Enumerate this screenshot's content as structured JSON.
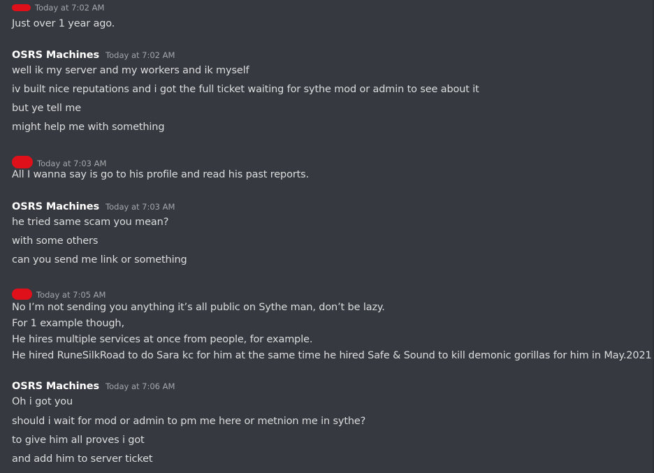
{
  "messages": [
    {
      "author": "",
      "timestamp": "Today at 7:02 AM",
      "lines": [
        "Just over 1 year ago."
      ]
    },
    {
      "author": "OSRS Machines",
      "timestamp": "Today at 7:02 AM",
      "lines": [
        "well ik my server and my workers and ik myself",
        "iv built nice reputations and i got the full ticket waiting for sythe mod or admin to see about it",
        "but ye tell me",
        "might help me with something"
      ]
    },
    {
      "author": "",
      "timestamp": "Today at 7:03 AM",
      "lines": [
        "All I wanna say is go to his profile and read his past reports."
      ]
    },
    {
      "author": "OSRS Machines",
      "timestamp": "Today at 7:03 AM",
      "lines": [
        "he tried same scam you mean?",
        "with some others",
        "can you send me link or something"
      ]
    },
    {
      "author": "",
      "timestamp": "Today at 7:05 AM",
      "lines": [
        "No I’m not sending you anything it’s all public on Sythe man, don’t be lazy.",
        "For 1 example though,",
        "He hires multiple services at once from people, for example.",
        "He hired RuneSilkRoad to do Sara kc for him at the same time he hired Safe & Sound to kill demonic gorillas for him in May.2021."
      ]
    },
    {
      "author": "OSRS Machines",
      "timestamp": "Today at 7:06 AM",
      "lines": [
        "Oh i got you",
        "should i wait for mod or admin to pm me here or metnion me in sythe?",
        "to give him all proves i got",
        "and add him to server ticket"
      ]
    }
  ]
}
